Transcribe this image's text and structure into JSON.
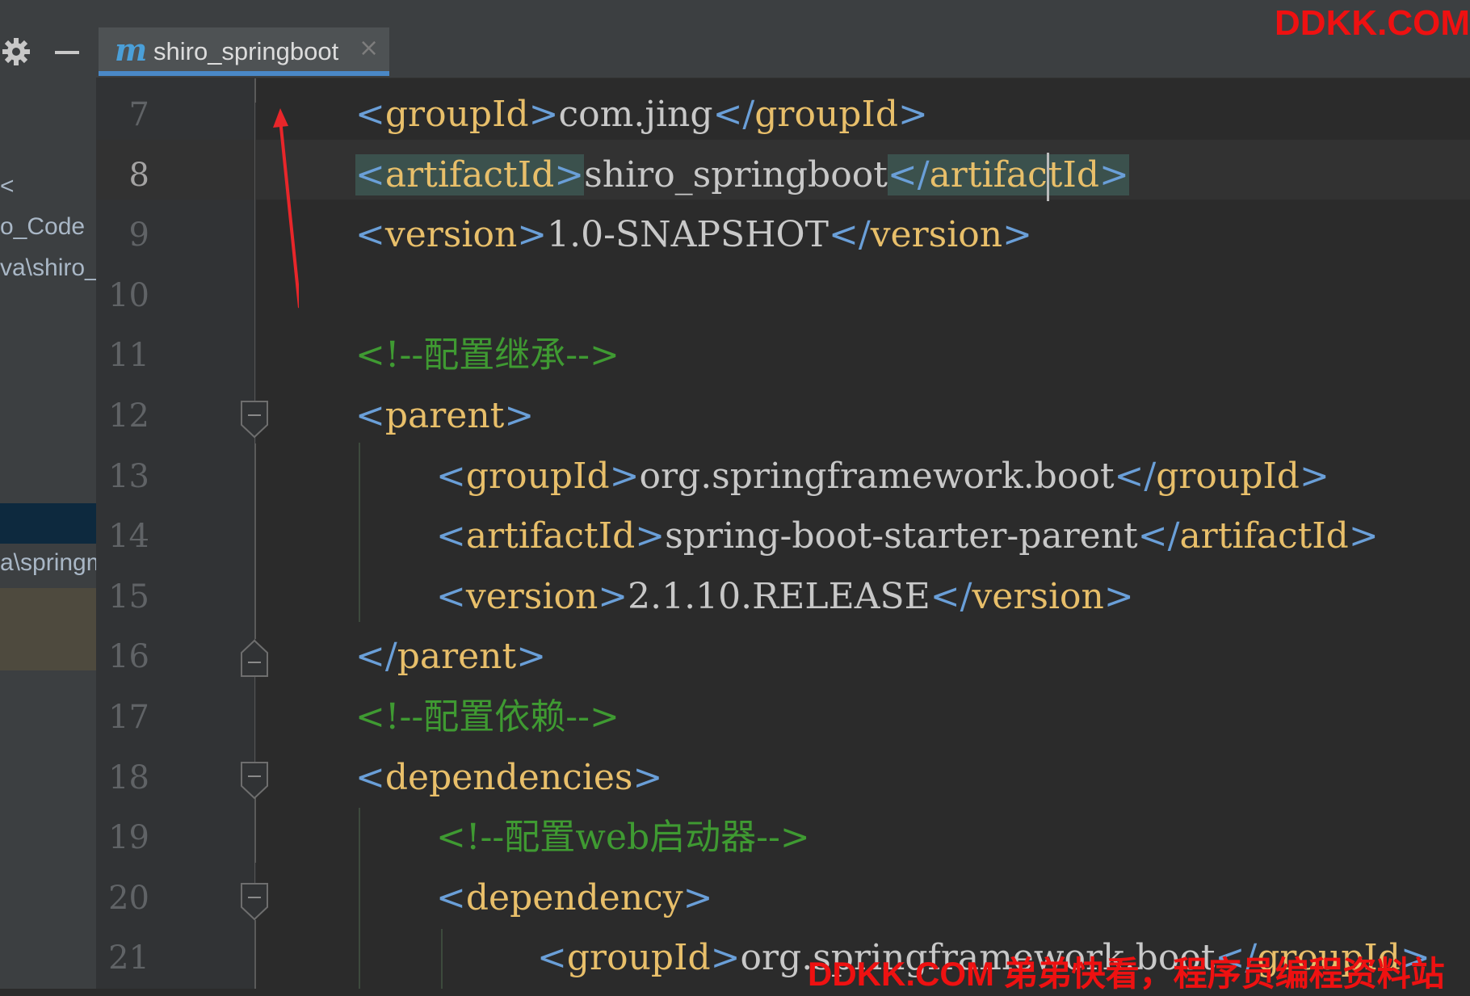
{
  "sidebar": {
    "partial_items": [
      "<",
      "o_Code",
      "va\\shiro_",
      "a\\springm"
    ]
  },
  "tab": {
    "icon_letter": "m",
    "label": "shiro_springboot",
    "close": "×"
  },
  "watermarks": {
    "top": "DDKK.COM",
    "bottom": "DDKK.COM 弟弟快看，程序员编程资料站"
  },
  "editor": {
    "current_line": 8,
    "line_numbers": [
      "7",
      "8",
      "9",
      "10",
      "11",
      "12",
      "13",
      "14",
      "15",
      "16",
      "17",
      "18",
      "19",
      "20",
      "21"
    ],
    "lines": [
      {
        "n": 7,
        "indent": 1,
        "parts": [
          {
            "t": "b",
            "v": "<"
          },
          {
            "t": "g",
            "v": "groupId"
          },
          {
            "t": "b",
            "v": ">"
          },
          {
            "t": "x",
            "v": "com.jing"
          },
          {
            "t": "b",
            "v": "</"
          },
          {
            "t": "g",
            "v": "groupId"
          },
          {
            "t": "b",
            "v": ">"
          }
        ]
      },
      {
        "n": 8,
        "indent": 1,
        "parts": [
          {
            "t": "b",
            "v": "<"
          },
          {
            "t": "g",
            "v": "artifactId"
          },
          {
            "t": "b",
            "v": ">"
          },
          {
            "t": "x",
            "v": "shiro_springboot"
          },
          {
            "t": "b",
            "v": "</"
          },
          {
            "t": "g",
            "v": "artifactId"
          },
          {
            "t": "b",
            "v": ">"
          }
        ]
      },
      {
        "n": 9,
        "indent": 1,
        "parts": [
          {
            "t": "b",
            "v": "<"
          },
          {
            "t": "g",
            "v": "version"
          },
          {
            "t": "b",
            "v": ">"
          },
          {
            "t": "x",
            "v": "1.0-SNAPSHOT"
          },
          {
            "t": "b",
            "v": "</"
          },
          {
            "t": "g",
            "v": "version"
          },
          {
            "t": "b",
            "v": ">"
          }
        ]
      },
      {
        "n": 10,
        "indent": 1,
        "parts": []
      },
      {
        "n": 11,
        "indent": 1,
        "parts": [
          {
            "t": "c",
            "v": "<!--配置继承-->"
          }
        ]
      },
      {
        "n": 12,
        "indent": 1,
        "parts": [
          {
            "t": "b",
            "v": "<"
          },
          {
            "t": "g",
            "v": "parent"
          },
          {
            "t": "b",
            "v": ">"
          }
        ]
      },
      {
        "n": 13,
        "indent": 2,
        "parts": [
          {
            "t": "b",
            "v": "<"
          },
          {
            "t": "g",
            "v": "groupId"
          },
          {
            "t": "b",
            "v": ">"
          },
          {
            "t": "x",
            "v": "org.springframework.boot"
          },
          {
            "t": "b",
            "v": "</"
          },
          {
            "t": "g",
            "v": "groupId"
          },
          {
            "t": "b",
            "v": ">"
          }
        ]
      },
      {
        "n": 14,
        "indent": 2,
        "parts": [
          {
            "t": "b",
            "v": "<"
          },
          {
            "t": "g",
            "v": "artifactId"
          },
          {
            "t": "b",
            "v": ">"
          },
          {
            "t": "x",
            "v": "spring-boot-starter-parent"
          },
          {
            "t": "b",
            "v": "</"
          },
          {
            "t": "g",
            "v": "artifactId"
          },
          {
            "t": "b",
            "v": ">"
          }
        ]
      },
      {
        "n": 15,
        "indent": 2,
        "parts": [
          {
            "t": "b",
            "v": "<"
          },
          {
            "t": "g",
            "v": "version"
          },
          {
            "t": "b",
            "v": ">"
          },
          {
            "t": "x",
            "v": "2.1.10.RELEASE"
          },
          {
            "t": "b",
            "v": "</"
          },
          {
            "t": "g",
            "v": "version"
          },
          {
            "t": "b",
            "v": ">"
          }
        ]
      },
      {
        "n": 16,
        "indent": 1,
        "parts": [
          {
            "t": "b",
            "v": "</"
          },
          {
            "t": "g",
            "v": "parent"
          },
          {
            "t": "b",
            "v": ">"
          }
        ]
      },
      {
        "n": 17,
        "indent": 1,
        "parts": [
          {
            "t": "c",
            "v": "<!--配置依赖-->"
          }
        ]
      },
      {
        "n": 18,
        "indent": 1,
        "parts": [
          {
            "t": "b",
            "v": "<"
          },
          {
            "t": "g",
            "v": "dependencies"
          },
          {
            "t": "b",
            "v": ">"
          }
        ]
      },
      {
        "n": 19,
        "indent": 2,
        "parts": [
          {
            "t": "c",
            "v": "<!--配置web启动器-->"
          }
        ]
      },
      {
        "n": 20,
        "indent": 2,
        "parts": [
          {
            "t": "b",
            "v": "<"
          },
          {
            "t": "g",
            "v": "dependency"
          },
          {
            "t": "b",
            "v": ">"
          }
        ]
      },
      {
        "n": 21,
        "indent": 3,
        "parts": [
          {
            "t": "b",
            "v": "<"
          },
          {
            "t": "g",
            "v": "groupId"
          },
          {
            "t": "b",
            "v": ">"
          },
          {
            "t": "x",
            "v": "org.springframework.boot"
          },
          {
            "t": "b",
            "v": "</"
          },
          {
            "t": "g",
            "v": "groupId"
          },
          {
            "t": "b",
            "v": ">"
          }
        ]
      }
    ]
  },
  "colors": {
    "editor_bg": "#2b2b2b",
    "tag": "#e8bf6a",
    "bracket": "#6a9fd8",
    "text": "#c8c8c8",
    "comment": "#3f9a32",
    "annotation_arrow": "#e8262a"
  }
}
